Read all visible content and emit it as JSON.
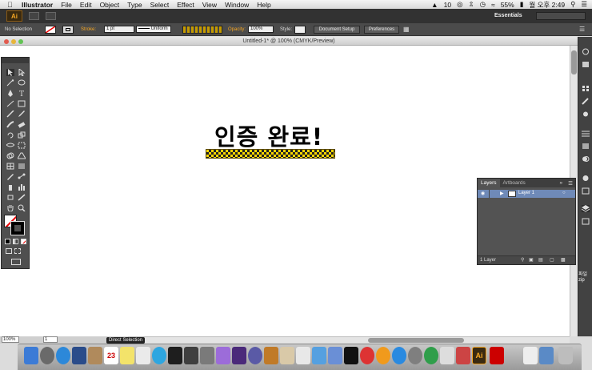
{
  "menubar": {
    "app_name": "Illustrator",
    "items": [
      "File",
      "Edit",
      "Object",
      "Type",
      "Select",
      "Effect",
      "View",
      "Window",
      "Help"
    ],
    "status": {
      "badge": "10",
      "battery": "55%",
      "clock": "월 오후 2:49"
    }
  },
  "appbar": {
    "logo": "Ai",
    "workspace": "Essentials",
    "search_placeholder": ""
  },
  "control": {
    "selection": "No Selection",
    "stroke_label": "Stroke:",
    "stroke_value": "1 pt",
    "profile": "Uniform",
    "opacity_label": "Opacity:",
    "opacity_value": "100%",
    "style_label": "Style:",
    "doc_setup": "Document Setup",
    "preferences": "Preferences"
  },
  "document": {
    "title": "Untitled-1* @ 100% (CMYK/Preview)",
    "art_text": "인증 완료!"
  },
  "statusbar": {
    "zoom": "100%",
    "artboard": "1",
    "tool": "Direct Selection"
  },
  "layers_panel": {
    "tabs": [
      "Layers",
      "Artboards"
    ],
    "layer_name": "Layer 1",
    "footer": "1 Layer"
  },
  "dock_labels": {
    "date": "23",
    "illustrator": "Ai",
    "desktop_a": "파일",
    "desktop_b": "zip"
  },
  "colors": {
    "accent_orange": "#f5a623",
    "ui_dark": "#4b4b4b",
    "layer_selection": "#6f8ab8",
    "art_fill": "#fbd700"
  }
}
